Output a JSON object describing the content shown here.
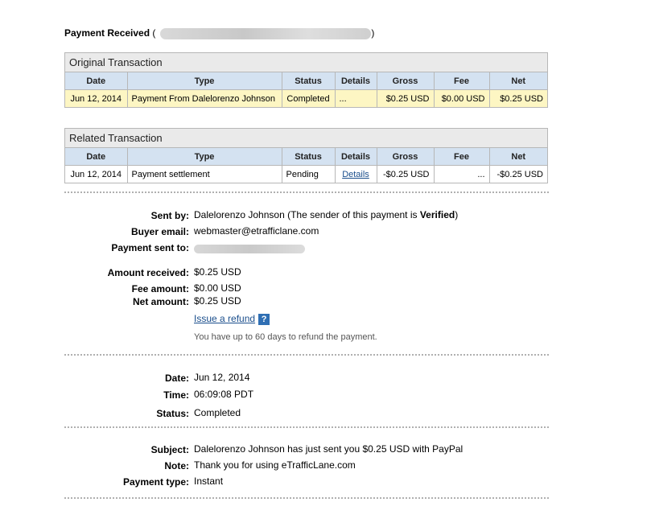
{
  "header": {
    "title": "Payment Received",
    "paren_open": "(",
    "paren_close": ")"
  },
  "original": {
    "heading": "Original Transaction",
    "columns": [
      "Date",
      "Type",
      "Status",
      "Details",
      "Gross",
      "Fee",
      "Net"
    ],
    "row": {
      "date": "Jun 12, 2014",
      "type": "Payment From Dalelorenzo Johnson",
      "status": "Completed",
      "details": "...",
      "gross": "$0.25 USD",
      "fee": "$0.00 USD",
      "net": "$0.25 USD"
    }
  },
  "related": {
    "heading": "Related Transaction",
    "columns": [
      "Date",
      "Type",
      "Status",
      "Details",
      "Gross",
      "Fee",
      "Net"
    ],
    "row": {
      "date": "Jun 12, 2014",
      "type": "Payment settlement",
      "status": "Pending",
      "details": "Details",
      "gross": "-$0.25 USD",
      "fee": "...",
      "net": "-$0.25 USD"
    }
  },
  "sender": {
    "sent_by_label": "Sent by:",
    "sent_by_name": "Dalelorenzo Johnson",
    "sent_by_note_prefix": "(The sender of this payment is ",
    "sent_by_verified": "Verified",
    "sent_by_note_suffix": ")",
    "buyer_email_label": "Buyer email:",
    "buyer_email": "webmaster@etrafficlane.com",
    "payment_sent_to_label": "Payment sent to:"
  },
  "amounts": {
    "amount_received_label": "Amount received:",
    "amount_received": "$0.25 USD",
    "fee_label": "Fee amount:",
    "fee": "$0.00 USD",
    "net_label": "Net amount:",
    "net": "$0.25 USD",
    "refund_link": "Issue a refund",
    "help_glyph": "?",
    "refund_note": "You have up to 60 days to refund the payment."
  },
  "timing": {
    "date_label": "Date:",
    "date": "Jun 12, 2014",
    "time_label": "Time:",
    "time": "06:09:08 PDT",
    "status_label": "Status:",
    "status": "Completed"
  },
  "message": {
    "subject_label": "Subject:",
    "subject": "Dalelorenzo Johnson has just sent you $0.25 USD with PayPal",
    "note_label": "Note:",
    "note": "Thank you for using eTrafficLane.com",
    "payment_type_label": "Payment type:",
    "payment_type": "Instant"
  },
  "colors": {
    "header_bg": "#d4e2f1",
    "row_highlight": "#fdf6c3",
    "link": "#1a4e8c",
    "help_icon": "#2f6fb4"
  }
}
